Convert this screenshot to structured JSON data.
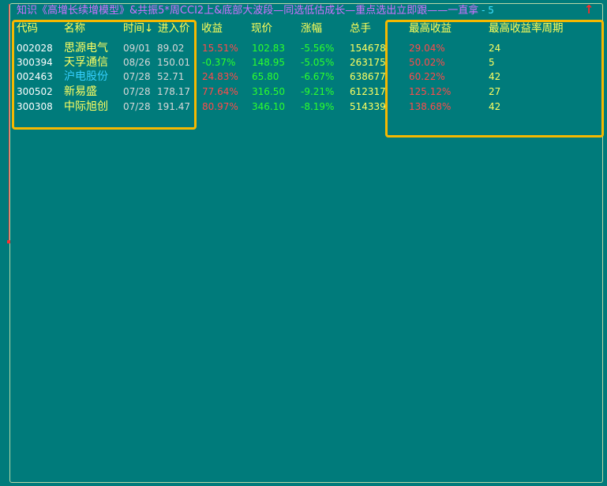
{
  "title": {
    "text": "知识《高增长续增模型》&共振5*周CCI2上&底部大波段—同选低估成长—重点选出立即跟——一直拿",
    "suffix": " - 5"
  },
  "headers": {
    "code": "代码",
    "name": "名称",
    "time": "时间↓",
    "entry_price": "进入价",
    "gain": "收益",
    "price": "现价",
    "change": "涨幅",
    "volume": "总手",
    "max_gain": "最高收益",
    "max_gain_period": "最高收益率周期"
  },
  "rows": [
    {
      "code": "002028",
      "name": "思源电气",
      "time": "09/01",
      "entry_price": "89.02",
      "gain": "15.51%",
      "price": "102.83",
      "change": "-5.56%",
      "volume": "154678",
      "max_gain": "29.04%",
      "period": "24",
      "name_color": "#ffff60"
    },
    {
      "code": "300394",
      "name": "天孚通信",
      "time": "08/26",
      "entry_price": "150.01",
      "gain": "-0.37%",
      "price": "148.95",
      "change": "-5.05%",
      "volume": "263175",
      "max_gain": "50.02%",
      "period": "5",
      "name_color": "#ffff60"
    },
    {
      "code": "002463",
      "name": "沪电股份",
      "time": "07/28",
      "entry_price": "52.71",
      "gain": "24.83%",
      "price": "65.80",
      "change": "-6.67%",
      "volume": "638677",
      "max_gain": "60.22%",
      "period": "42",
      "name_color": "#35d0ff"
    },
    {
      "code": "300502",
      "name": "新易盛",
      "time": "07/28",
      "entry_price": "178.17",
      "gain": "77.64%",
      "price": "316.50",
      "change": "-9.21%",
      "volume": "612317",
      "max_gain": "125.12%",
      "period": "27",
      "name_color": "#ffff60"
    },
    {
      "code": "300308",
      "name": "中际旭创",
      "time": "07/28",
      "entry_price": "191.47",
      "gain": "80.97%",
      "price": "346.10",
      "change": "-8.19%",
      "volume": "514339",
      "max_gain": "138.68%",
      "period": "42",
      "name_color": "#ffff60"
    }
  ],
  "colors": {
    "background": "#007b7b",
    "header": "#ffff58",
    "title": "#d070ff",
    "positive": "#ff4a4a",
    "negative": "#2cff2c",
    "highlight_box": "#f5b800"
  },
  "icons": {
    "sort_indicator": "down-arrow-icon",
    "top_right": "red-up-arrow-icon"
  }
}
